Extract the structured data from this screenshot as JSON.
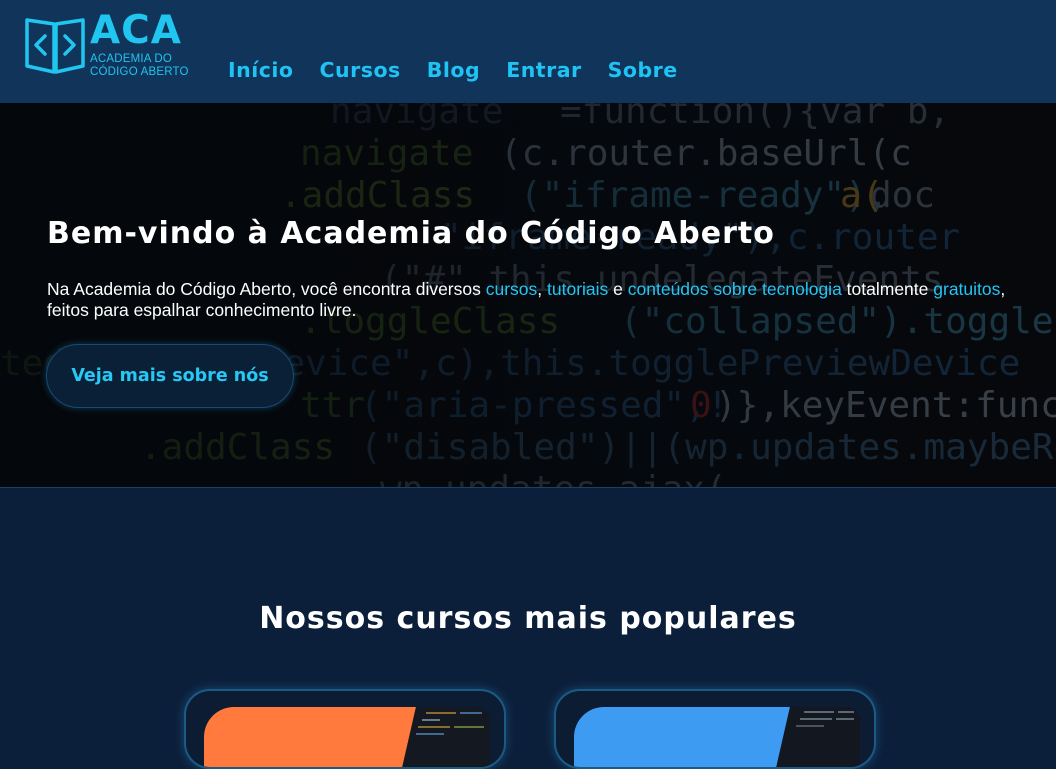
{
  "brand": {
    "abbr": "ACA",
    "name_line1": "ACADEMIA DO",
    "name_line2": "CÓDIGO ABERTO",
    "accent_color": "#20c5f0"
  },
  "nav": {
    "items": [
      {
        "label": "Início"
      },
      {
        "label": "Cursos"
      },
      {
        "label": "Blog"
      },
      {
        "label": "Entrar"
      },
      {
        "label": "Sobre"
      }
    ]
  },
  "hero": {
    "title": "Bem-vindo à Academia do Código Aberto",
    "text_part1": "Na Academia do Código Aberto, você encontra diversos ",
    "link_cursos": "cursos",
    "sep1": ", ",
    "link_tutoriais": "tutoriais",
    "sep2": " e ",
    "link_conteudos": "conteúdos sobre tecnologia",
    "text_part2": " totalmente ",
    "link_gratuitos": "gratuitos",
    "text_part3": ", feitos para espalhar conhecimento livre.",
    "button_label": "Veja mais sobre nós"
  },
  "courses": {
    "title": "Nossos cursos mais populares",
    "cards": [
      {
        "name": "course-card-orange",
        "color": "#ff7a3c"
      },
      {
        "name": "course-card-blue",
        "color": "#3d9cf2"
      }
    ]
  },
  "colors": {
    "header_bg": "#10345a",
    "page_bg": "#0c1f3a",
    "link": "#22c6f5"
  }
}
